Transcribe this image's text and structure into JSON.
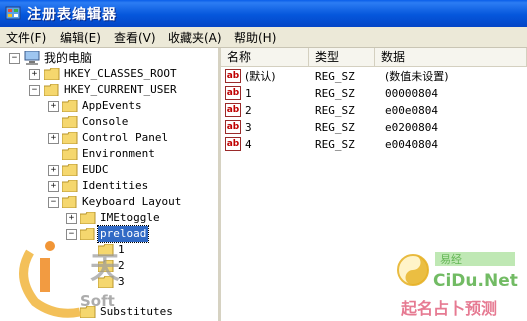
{
  "window": {
    "title": "注册表编辑器"
  },
  "menu": [
    {
      "label": "文件(F)"
    },
    {
      "label": "编辑(E)"
    },
    {
      "label": "查看(V)"
    },
    {
      "label": "收藏夹(A)"
    },
    {
      "label": "帮助(H)"
    }
  ],
  "tree": {
    "root": "我的电脑",
    "hkcr": "HKEY_CLASSES_ROOT",
    "hkcu": "HKEY_CURRENT_USER",
    "children": [
      "AppEvents",
      "Console",
      "Control Panel",
      "Environment",
      "EUDC",
      "Identities",
      "Keyboard Layout"
    ],
    "kl_children": [
      "IMEtoggle",
      "preload"
    ],
    "preload_children": [
      "1",
      "2",
      "3"
    ],
    "after": "Substitutes"
  },
  "list": {
    "headers": [
      "名称",
      "类型",
      "数据"
    ],
    "rows": [
      {
        "name": "(默认)",
        "type": "REG_SZ",
        "data": "(数值未设置)"
      },
      {
        "name": "1",
        "type": "REG_SZ",
        "data": "00000804"
      },
      {
        "name": "2",
        "type": "REG_SZ",
        "data": "e00e0804"
      },
      {
        "name": "3",
        "type": "REG_SZ",
        "data": "e0200804"
      },
      {
        "name": "4",
        "type": "REG_SZ",
        "data": "e0040804"
      }
    ],
    "value_icon": "ab"
  },
  "watermarks": {
    "left_text": "天",
    "left_sub": "Soft",
    "right_site": "CiDu.Net",
    "right_cn": "起名占卜预测",
    "right_cn_top": "易经"
  },
  "colors": {
    "titlebar": "#0557dc",
    "selection": "#316ac5",
    "folder": "#f5d76e"
  }
}
